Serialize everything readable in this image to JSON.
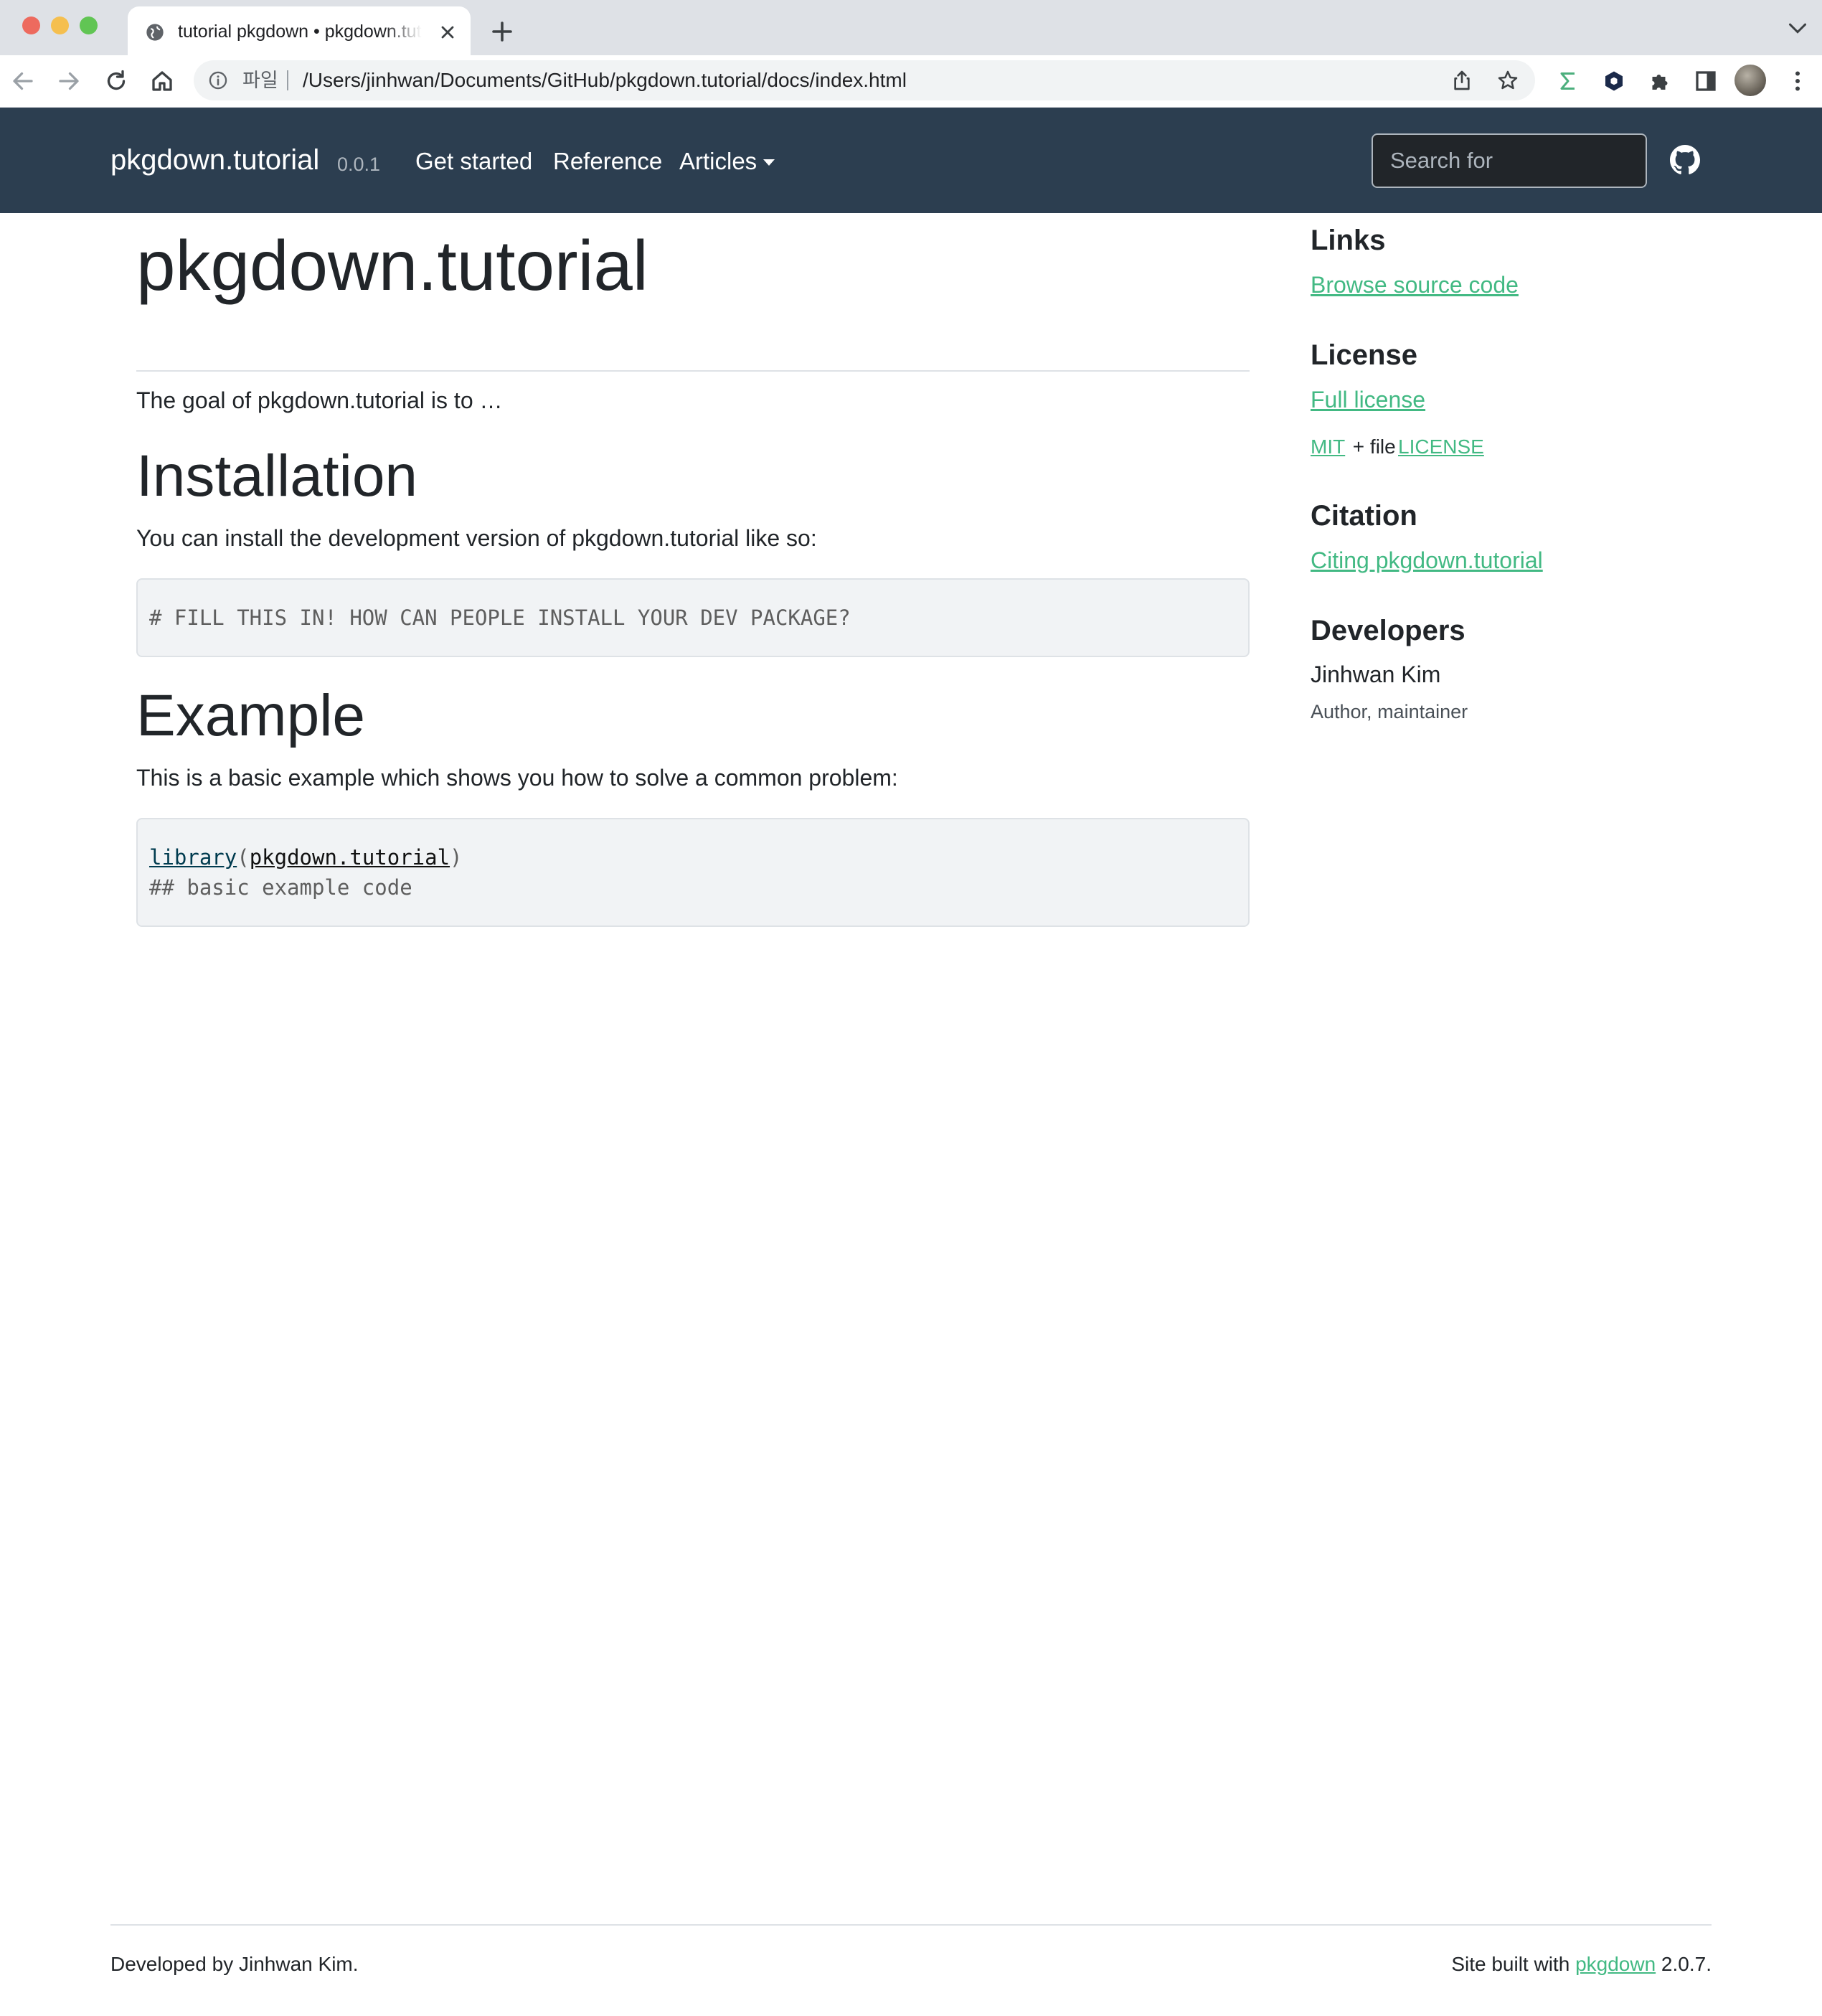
{
  "browser": {
    "tab_title": "tutorial pkgdown • pkgdown.tutorial",
    "url_scheme_label": "파일",
    "url": "/Users/jinhwan/Documents/GitHub/pkgdown.tutorial/docs/index.html",
    "colors": {
      "tabbar": "#dee1e6",
      "toolbar": "#ffffff",
      "omnibox": "#f1f3f4"
    }
  },
  "navbar": {
    "brand": "pkgdown.tutorial",
    "version": "0.0.1",
    "links": [
      "Get started",
      "Reference",
      "Articles"
    ],
    "search_placeholder": "Search for",
    "background": "#2c3e50"
  },
  "main": {
    "title": "pkgdown.tutorial",
    "intro": "The goal of pkgdown.tutorial is to …",
    "installation": {
      "heading": "Installation",
      "text": "You can install the development version of pkgdown.tutorial like so:",
      "code": "# FILL THIS IN! HOW CAN PEOPLE INSTALL YOUR DEV PACKAGE?"
    },
    "example": {
      "heading": "Example",
      "text": "This is a basic example which shows you how to solve a common problem:",
      "code_fn": "library",
      "code_open": "(",
      "code_arg": "pkgdown.tutorial",
      "code_close": ")",
      "code_comment": "## basic example code"
    }
  },
  "sidebar": {
    "links_heading": "Links",
    "browse_source": "Browse source code",
    "license_heading": "License",
    "full_license": "Full license",
    "mit": "MIT",
    "plus_file": " + file ",
    "license_file": "LICENSE",
    "citation_heading": "Citation",
    "citing": "Citing pkgdown.tutorial",
    "developers_heading": "Developers",
    "developer_name": "Jinhwan Kim",
    "developer_role": "Author, maintainer",
    "link_color": "#42b983"
  },
  "footer": {
    "left": "Developed by Jinhwan Kim.",
    "right_prefix": "Site built with ",
    "right_link": "pkgdown",
    "right_suffix": " 2.0.7."
  }
}
